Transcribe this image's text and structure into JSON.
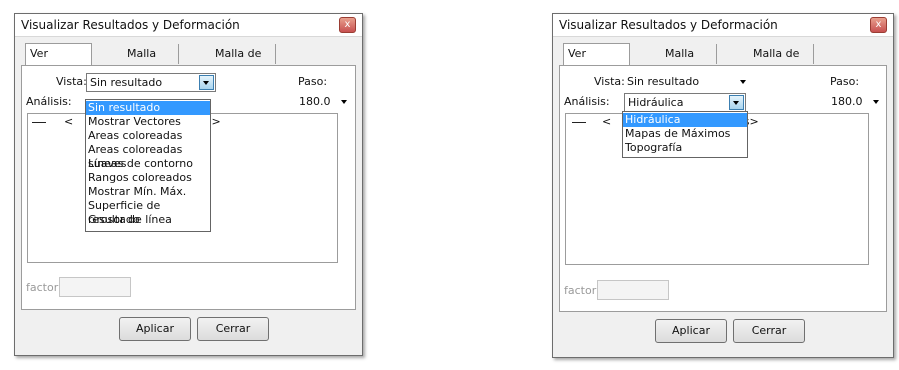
{
  "left_dialog": {
    "title": "Visualizar Resultados y Deformación",
    "tabs": [
      "Ver resultados",
      "Malla Principal",
      "Malla de referencia"
    ],
    "vista_label": "Vista:",
    "vista_value": "Sin resultado",
    "paso_label": "Paso:",
    "paso_value": "180.0",
    "analisis_label": "Análisis:",
    "list_partial_text": "<",
    "list_partial_tail": "os>",
    "dropdown_options": [
      "Sin resultado",
      "Mostrar Vectores",
      "Areas coloreadas",
      "Areas coloreadas suaves",
      "Líneas de contorno",
      "Rangos coloreados",
      "Mostrar Mín. Máx.",
      "Superficie de resultado",
      "Grosor de línea"
    ],
    "dropdown_selected": "Sin resultado",
    "factor_label": "factor:",
    "apply_label": "Aplicar",
    "close_label": "Cerrar"
  },
  "right_dialog": {
    "title": "Visualizar Resultados y Deformación",
    "tabs": [
      "Ver resultados",
      "Malla Principal",
      "Malla de referencia"
    ],
    "vista_label": "Vista:",
    "vista_value": "Sin resultado",
    "paso_label": "Paso:",
    "paso_value": "180.0",
    "analisis_label": "Análisis:",
    "analisis_value": "Hidráulica",
    "list_partial_text": "<",
    "list_partial_tail": "os>",
    "dropdown_options": [
      "Hidráulica",
      "Mapas de Máximos",
      "Topografía"
    ],
    "dropdown_selected": "Hidráulica",
    "factor_label": "factor:",
    "apply_label": "Aplicar",
    "close_label": "Cerrar"
  },
  "icons": {
    "close": "close-icon",
    "dropdown": "chevron-down-icon"
  }
}
